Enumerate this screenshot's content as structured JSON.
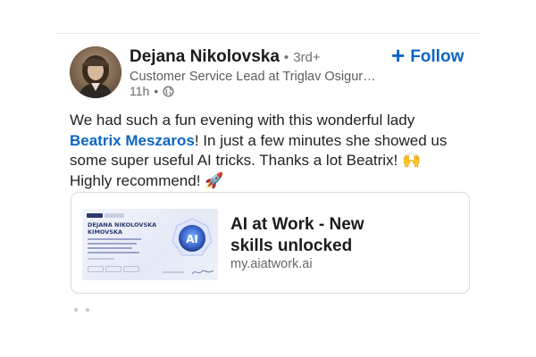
{
  "author": {
    "name": "Dejana Nikolovska",
    "separator": "•",
    "degree": "3rd+",
    "headline": "Customer Service Lead at Triglav Osigur…",
    "time": "11h",
    "time_separator": "•",
    "visibility_icon": "globe-icon"
  },
  "follow": {
    "label": "Follow",
    "plus": "+"
  },
  "post": {
    "text_before": "We had such a fun evening with this wonderful lady",
    "mention": "Beatrix Meszaros",
    "text_after": "! In just a few minutes she showed us some super useful AI tricks. Thanks a lot Beatrix! 🙌 Highly recommend! 🚀"
  },
  "link_preview": {
    "title": "AI at Work - New skills unlocked",
    "url": "my.aiatwork.ai",
    "thumbnail": {
      "badge": "AI",
      "person_name_line1": "DEJANA NIKOLOVSKA",
      "person_name_line2": "KIMOVSKA"
    }
  },
  "colors": {
    "brand_blue": "#0a66c2",
    "text_primary": "#1b1b1b",
    "text_secondary": "#5e5e5e"
  }
}
